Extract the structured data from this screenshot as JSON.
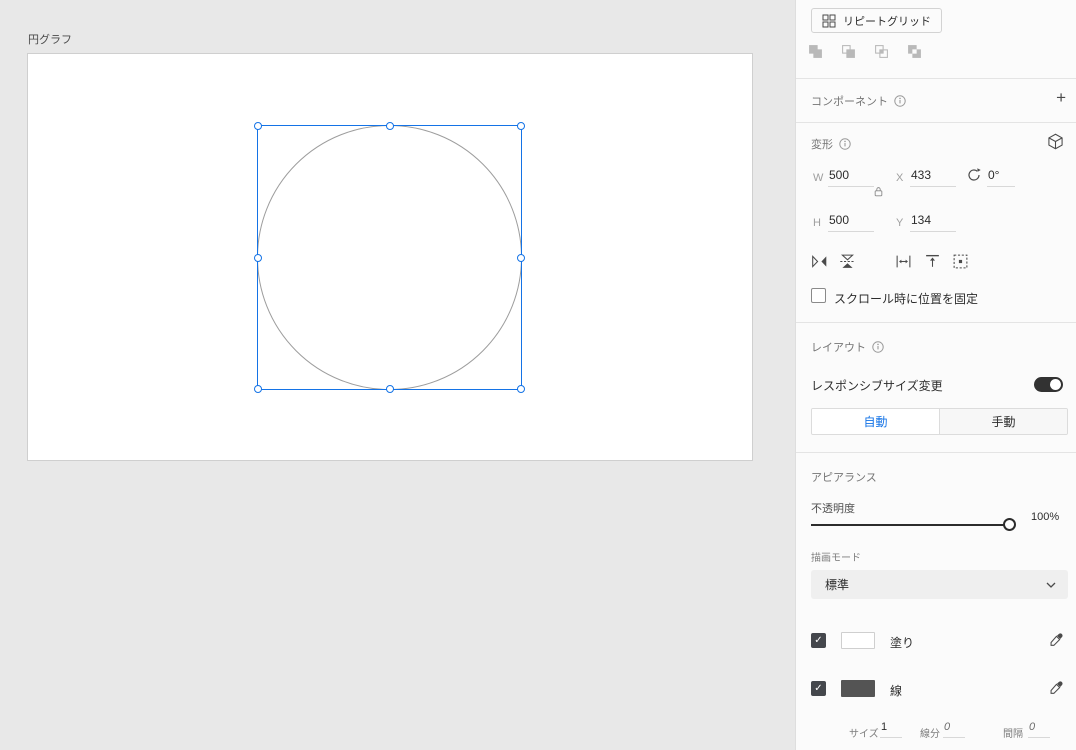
{
  "artboard": {
    "title": "円グラフ"
  },
  "toolbar": {
    "repeat_grid_label": "リピートグリッド"
  },
  "component": {
    "header": "コンポーネント"
  },
  "transform": {
    "header": "変形",
    "w_label": "W",
    "w_value": "500",
    "x_label": "X",
    "x_value": "433",
    "h_label": "H",
    "h_value": "500",
    "y_label": "Y",
    "y_value": "134",
    "rotation_value": "0°",
    "fix_on_scroll_label": "スクロール時に位置を固定"
  },
  "layout": {
    "header": "レイアウト",
    "responsive_resize_label": "レスポンシブサイズ変更",
    "auto_label": "自動",
    "manual_label": "手動"
  },
  "appearance": {
    "header": "アピアランス",
    "opacity_label": "不透明度",
    "opacity_value": "100%",
    "blend_mode_label": "描画モード",
    "blend_mode_value": "標準",
    "fill_label": "塗り",
    "stroke_label": "線",
    "stroke_size_label": "サイズ",
    "stroke_size_value": "1",
    "dash_label": "線分",
    "dash_value": "0",
    "gap_label": "間隔",
    "gap_value": "0"
  },
  "colors": {
    "accent": "#1473e6",
    "selection_blue": "#1473e6",
    "fill_swatch": "#ffffff",
    "stroke_swatch": "#545454",
    "toggle_on": "#323232",
    "checkbox_checked": "#44474c"
  },
  "glyphs": {
    "plus": "+",
    "check": "✓"
  }
}
